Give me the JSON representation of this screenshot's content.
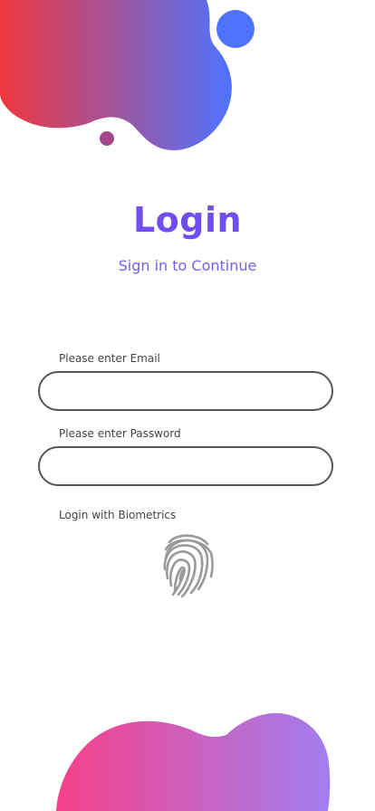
{
  "header": {
    "title": "Login",
    "subtitle": "Sign in to Continue"
  },
  "form": {
    "email_label": "Please enter Email",
    "email_value": "",
    "password_label": "Please enter Password",
    "password_value": "",
    "biometrics_label": "Login with Biometrics"
  },
  "icons": {
    "fingerprint": "fingerprint-icon"
  },
  "colors": {
    "accent": "#6f4df0",
    "top_gradient_start": "#f0373d",
    "top_gradient_end": "#4f73ff",
    "bottom_gradient_start": "#f6418a",
    "bottom_gradient_end": "#a27ef0",
    "dot_blue": "#4f73ff",
    "dot_purple": "#a4478b"
  }
}
